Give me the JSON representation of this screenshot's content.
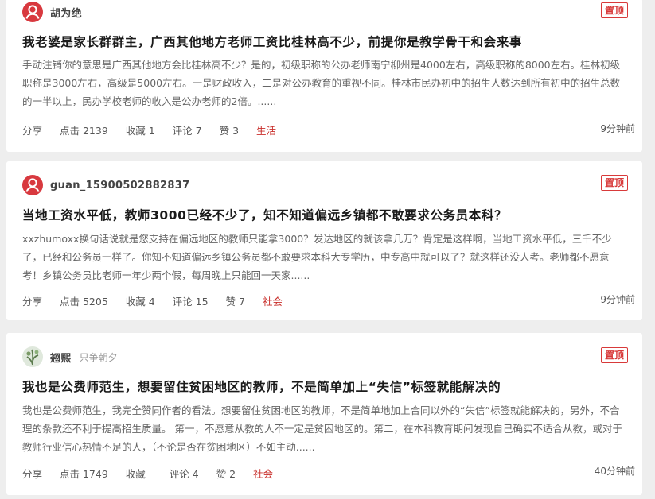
{
  "posts": [
    {
      "author": "胡为绝",
      "author_sub": "",
      "pin_label": "置顶",
      "title": "我老婆是家长群群主，广西其他地方老师工资比桂林高不少，前提你是教学骨干和会来事",
      "excerpt": "手动注销你的意思是广西其他地方会比桂林高不少？是的，初级职称的公办老师南宁柳州是4000左右，高级职称的8000左右。桂林初级职称是3000左右，高级是5000左右。一是财政收入，二是对公办教育的重视不同。桂林市民办初中的招生人数达到所有初中的招生总数的一半以上，民办学校老师的收入是公办老师的2倍。......",
      "share": "分享",
      "clicks": "点击 2139",
      "favorites": "收藏 1",
      "comments": "评论 7",
      "likes": "赞 3",
      "category": "生活",
      "time": "9分钟前"
    },
    {
      "author": "guan_15900502882837",
      "author_sub": "",
      "pin_label": "置顶",
      "title": "当地工资水平低，教师3000已经不少了，知不知道偏远乡镇都不敢要求公务员本科？",
      "excerpt": "xxzhumoxx换句话说就是您支持在偏远地区的教师只能拿3000？发达地区的就该拿几万？肯定是这样啊，当地工资水平低，三千不少了，已经和公务员一样了。你知不知道偏远乡镇公务员都不敢要求本科大专学历，中专高中就可以了？就这样还没人考。老师都不愿意考！乡镇公务员比老师一年少两个假，每周晚上只能回一天家......",
      "share": "分享",
      "clicks": "点击 5205",
      "favorites": "收藏 4",
      "comments": "评论 15",
      "likes": "赞 7",
      "category": "社会",
      "time": "9分钟前"
    },
    {
      "author": "翘熙",
      "author_sub": "只争朝夕",
      "pin_label": "置顶",
      "title": "我也是公费师范生，想要留住贫困地区的教师，不是简单加上“失信”标签就能解决的",
      "excerpt": "我也是公费师范生，我完全赞同作者的看法。想要留住贫困地区的教师，不是简单地加上合同以外的“失信”标签就能解决的，另外，不合理的条款还不利于提高招生质量。 第一，不愿意从教的人不一定是贫困地区的。第二，在本科教育期间发现自己确实不适合从教，或对于教师行业信心热情不足的人，（不论是否在贫困地区）不如主动......",
      "share": "分享",
      "clicks": "点击 1749",
      "favorites": "收藏",
      "comments": "评论 4",
      "likes": "赞 2",
      "category": "社会",
      "time": "40分钟前"
    }
  ]
}
